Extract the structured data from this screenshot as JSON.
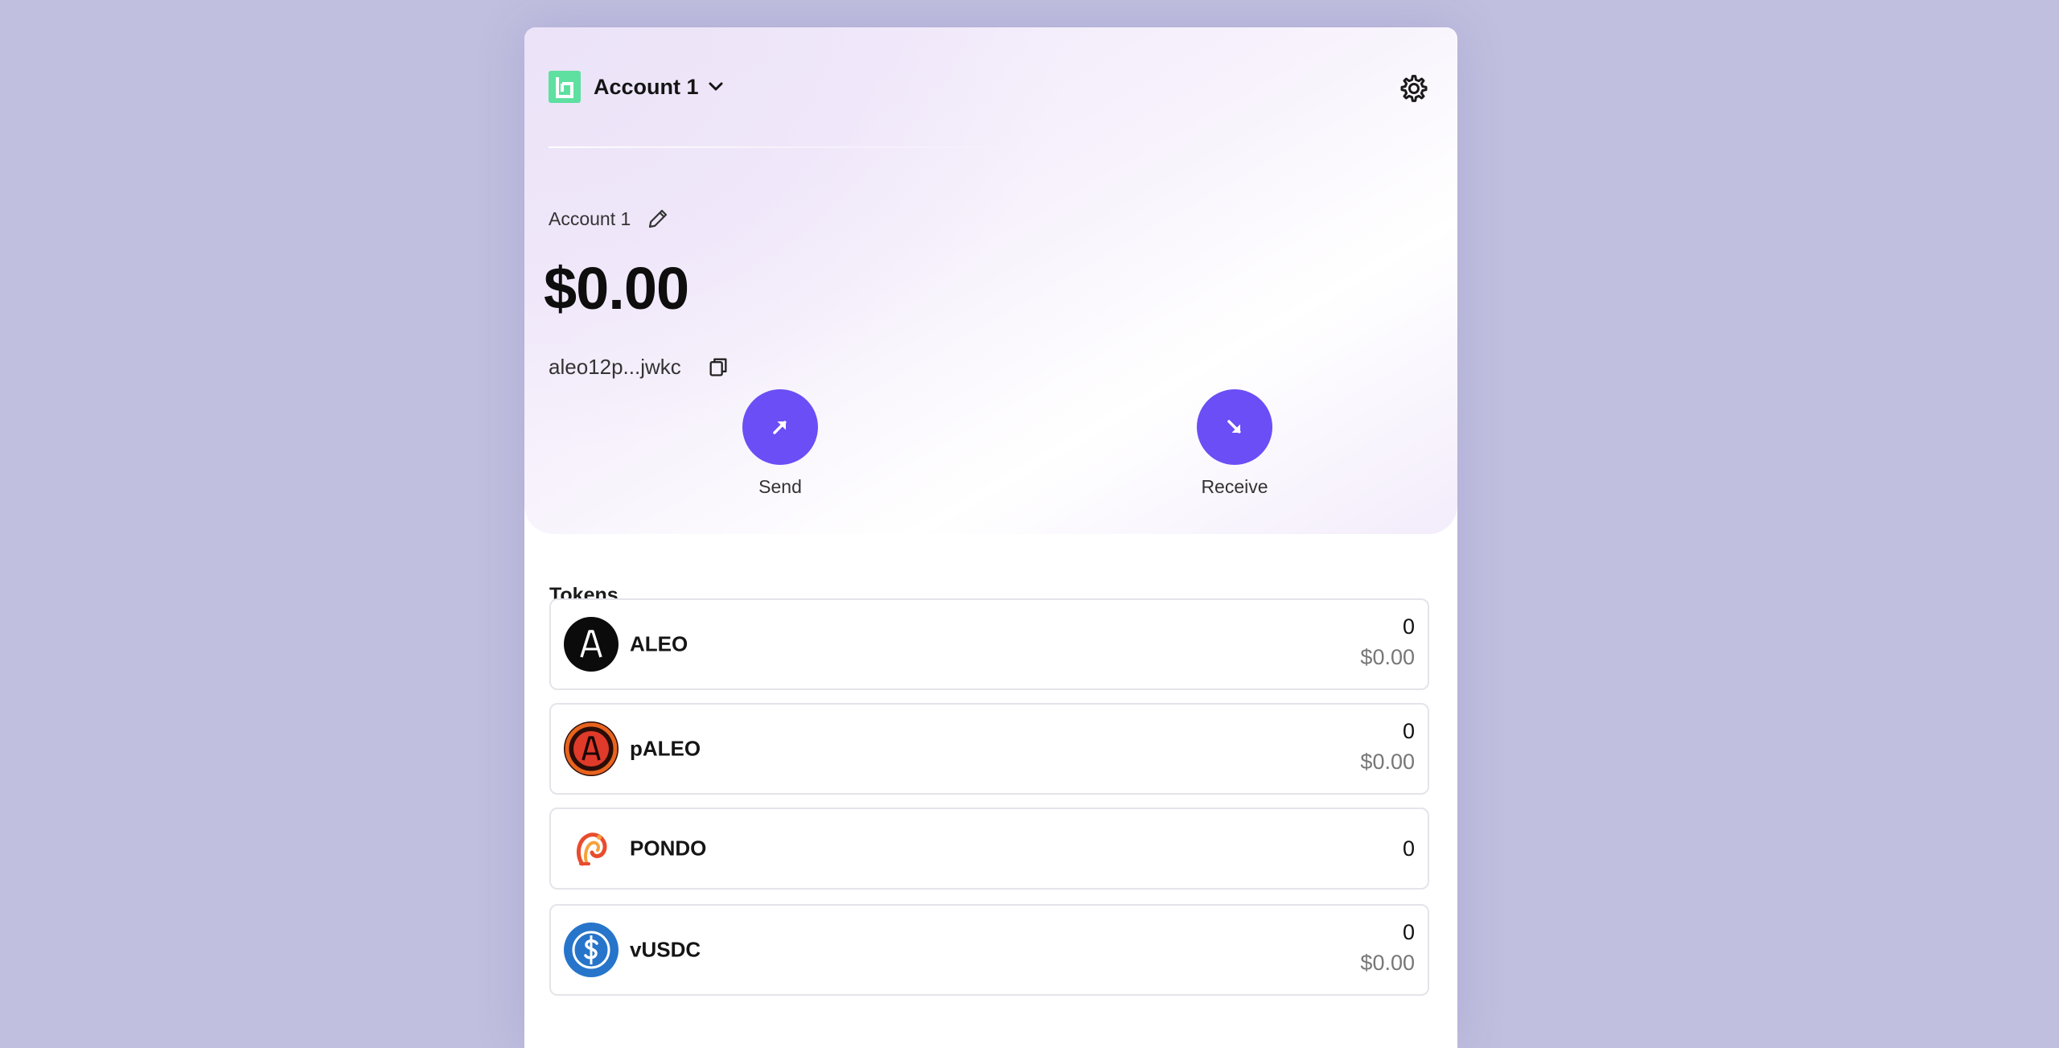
{
  "header": {
    "account_selector_label": "Account 1"
  },
  "account": {
    "name": "Account 1",
    "balance": "$0.00",
    "address": "aleo12p...jwkc"
  },
  "actions": {
    "send_label": "Send",
    "receive_label": "Receive"
  },
  "tokens": {
    "title": "Tokens",
    "items": [
      {
        "name": "ALEO",
        "amount": "0",
        "usd": "$0.00",
        "icon": "aleo-icon"
      },
      {
        "name": "pALEO",
        "amount": "0",
        "usd": "$0.00",
        "icon": "paleo-icon"
      },
      {
        "name": "PONDO",
        "amount": "0",
        "icon": "pondo-icon"
      },
      {
        "name": "vUSDC",
        "amount": "0",
        "usd": "$0.00",
        "icon": "usdc-icon"
      }
    ]
  },
  "colors": {
    "accent": "#6b4ef5",
    "logo": "#5ee0a0",
    "background": "#c0bfdf"
  }
}
